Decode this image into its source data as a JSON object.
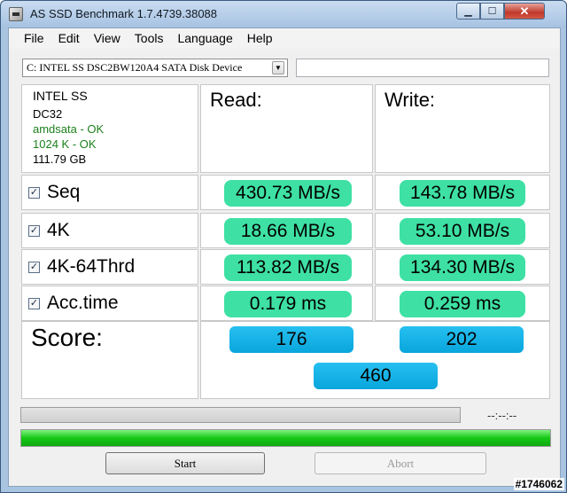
{
  "window": {
    "title": "AS SSD Benchmark 1.7.4739.38088"
  },
  "menu": [
    "File",
    "Edit",
    "View",
    "Tools",
    "Language",
    "Help"
  ],
  "drive": {
    "selected": "C: INTEL SS DSC2BW120A4 SATA Disk Device",
    "extra_field": ""
  },
  "info": {
    "model": "INTEL SS",
    "firmware": "DC32",
    "driver_status": "amdsata - OK",
    "alignment_status": "1024 K - OK",
    "capacity": "111.79 GB"
  },
  "columns": {
    "read": "Read:",
    "write": "Write:"
  },
  "rows": [
    {
      "name": "Seq",
      "checked": true,
      "read": "430.73 MB/s",
      "write": "143.78 MB/s"
    },
    {
      "name": "4K",
      "checked": true,
      "read": "18.66 MB/s",
      "write": "53.10 MB/s"
    },
    {
      "name": "4K-64Thrd",
      "checked": true,
      "read": "113.82 MB/s",
      "write": "134.30 MB/s"
    },
    {
      "name": "Acc.time",
      "checked": true,
      "read": "0.179 ms",
      "write": "0.259 ms"
    }
  ],
  "score": {
    "label": "Score:",
    "read": "176",
    "write": "202",
    "total": "460"
  },
  "progress": {
    "time_readout": "--:--:--",
    "overall_fraction": 1.0
  },
  "buttons": {
    "start": "Start",
    "abort": "Abort"
  },
  "watermark": "#1746062",
  "colors": {
    "value_fill": "#3ee0a4",
    "score_fill": "#12afe4",
    "progress_fill": "#16c816",
    "ok_text": "#1c7f1c"
  }
}
